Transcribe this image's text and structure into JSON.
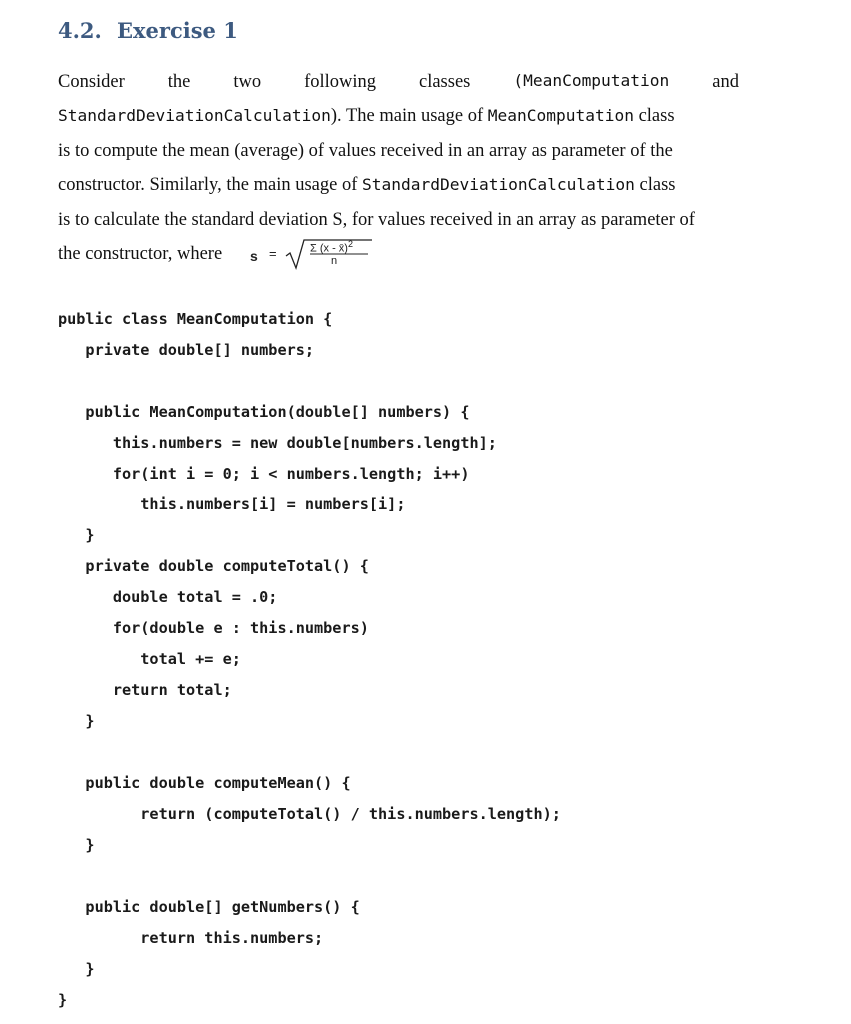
{
  "section": {
    "number": "4.2.",
    "title": "Exercise 1"
  },
  "paragraph": {
    "line1_words": [
      "Consider",
      "the",
      "two",
      "following",
      "classes",
      "(MeanComputation",
      "and"
    ],
    "line2": {
      "code1": "StandardDeviationCalculation",
      "text1": "). The main usage of ",
      "code2": "MeanComputation",
      "text2": " class"
    },
    "line3": "is to compute the mean (average) of values received in an array as parameter of the",
    "line4": {
      "text1": "constructor. Similarly, the main usage of ",
      "code1": "StandardDeviationCalculation",
      "text2": " class"
    },
    "line5": "is to calculate the standard deviation S, for values received in an array as parameter of",
    "line6": "the constructor, where"
  },
  "formula": {
    "lhs": "s",
    "equals": "=",
    "numerator": "Σ (x - x̄)",
    "exponent": "2",
    "denominator": "n"
  },
  "code": {
    "language": "java",
    "lines": [
      "public class MeanComputation {",
      "   private double[] numbers;",
      "",
      "   public MeanComputation(double[] numbers) {",
      "      this.numbers = new double[numbers.length];",
      "      for(int i = 0; i < numbers.length; i++)",
      "         this.numbers[i] = numbers[i];",
      "   }",
      "   private double computeTotal() {",
      "      double total = .0;",
      "      for(double e : this.numbers)",
      "         total += e;",
      "      return total;",
      "   }",
      "",
      "   public double computeMean() {",
      "         return (computeTotal() / this.numbers.length);",
      "   }",
      "",
      "   public double[] getNumbers() {",
      "         return this.numbers;",
      "   }",
      "}"
    ]
  }
}
